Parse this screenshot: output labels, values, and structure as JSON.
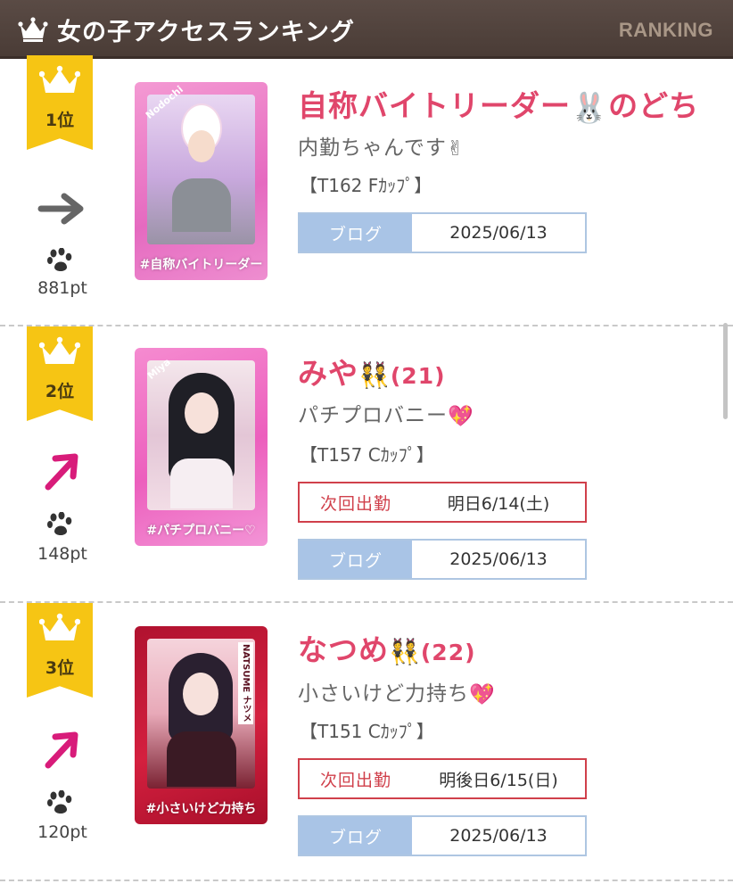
{
  "header": {
    "title": "女の子アクセスランキング",
    "label": "RANKING"
  },
  "colors": {
    "header_bg": "#4f413b",
    "ribbon": "#f6c514",
    "name": "#e0466b",
    "blog_label_bg": "#a9c4e6",
    "next_border": "#d0404b",
    "arrow_up": "#d81c7a",
    "arrow_flat": "#666666"
  },
  "entries": [
    {
      "rank": "1位",
      "trend": "flat-arrow-icon",
      "points": "881pt",
      "name": "自称バイトリーダー🐰のどち",
      "name_main": "自称バイトリーダー",
      "name_tail": "のどち",
      "age": "",
      "catch": "内勤ちゃんです",
      "spec": "【T162 Fｶｯﾌﾟ】",
      "card_tag": "Nodochi",
      "card_caption": "#自称バイトリーダー",
      "next_label": "",
      "next_value": "",
      "blog_label": "ブログ",
      "blog_date": "2025/06/13"
    },
    {
      "rank": "2位",
      "trend": "up-arrow-icon",
      "points": "148pt",
      "name_main": "みや",
      "age": "(21)",
      "catch": "パチプロバニー",
      "spec": "【T157 Cｶｯﾌﾟ】",
      "card_tag": "Miya",
      "card_caption": "#パチプロバニー♡",
      "next_label": "次回出勤",
      "next_value": "明日6/14(土)",
      "blog_label": "ブログ",
      "blog_date": "2025/06/13"
    },
    {
      "rank": "3位",
      "trend": "up-arrow-icon",
      "points": "120pt",
      "name_main": "なつめ",
      "age": "(22)",
      "catch": "小さいけど力持ち",
      "spec": "【T151 Cｶｯﾌﾟ】",
      "card_tag": "NATSUME ナツメ",
      "card_caption": "#小さいけど力持ち",
      "next_label": "次回出勤",
      "next_value": "明後日6/15(日)",
      "blog_label": "ブログ",
      "blog_date": "2025/06/13"
    }
  ]
}
